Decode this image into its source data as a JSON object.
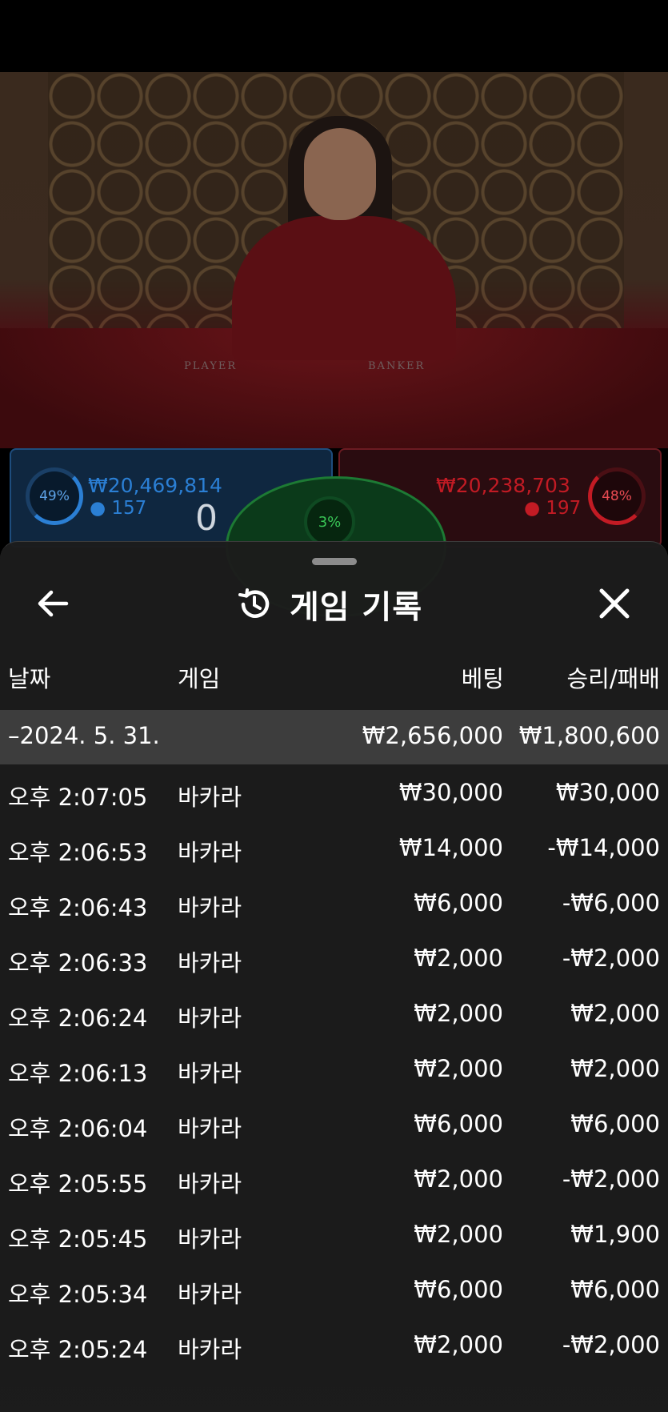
{
  "stream": {
    "player_label": "PLAYER",
    "banker_label": "BANKER"
  },
  "bets": {
    "player": {
      "percent": "49%",
      "amount": "₩20,469,814",
      "players": "157",
      "score": "0"
    },
    "tie": {
      "percent": "3%"
    },
    "banker": {
      "percent": "48%",
      "amount": "₩20,238,703",
      "players": "197"
    }
  },
  "sheet": {
    "title": "게임 기록",
    "columns": {
      "date": "날짜",
      "game": "게임",
      "bet": "베팅",
      "result": "승리/패배"
    },
    "summary": {
      "date": "–2024. 5. 31.",
      "bet": "₩2,656,000",
      "result": "₩1,800,600"
    },
    "rows": [
      {
        "time": "오후 2:07:05",
        "game": "바카라",
        "bet": "₩30,000",
        "result": "₩30,000"
      },
      {
        "time": "오후 2:06:53",
        "game": "바카라",
        "bet": "₩14,000",
        "result": "-₩14,000"
      },
      {
        "time": "오후 2:06:43",
        "game": "바카라",
        "bet": "₩6,000",
        "result": "-₩6,000"
      },
      {
        "time": "오후 2:06:33",
        "game": "바카라",
        "bet": "₩2,000",
        "result": "-₩2,000"
      },
      {
        "time": "오후 2:06:24",
        "game": "바카라",
        "bet": "₩2,000",
        "result": "₩2,000"
      },
      {
        "time": "오후 2:06:13",
        "game": "바카라",
        "bet": "₩2,000",
        "result": "₩2,000"
      },
      {
        "time": "오후 2:06:04",
        "game": "바카라",
        "bet": "₩6,000",
        "result": "₩6,000"
      },
      {
        "time": "오후 2:05:55",
        "game": "바카라",
        "bet": "₩2,000",
        "result": "-₩2,000"
      },
      {
        "time": "오후 2:05:45",
        "game": "바카라",
        "bet": "₩2,000",
        "result": "₩1,900"
      },
      {
        "time": "오후 2:05:34",
        "game": "바카라",
        "bet": "₩6,000",
        "result": "₩6,000"
      },
      {
        "time": "오후 2:05:24",
        "game": "바카라",
        "bet": "₩2,000",
        "result": "-₩2,000"
      }
    ]
  },
  "colors": {
    "player_blue": "#2b7fd4",
    "banker_red": "#c21b24",
    "tie_green": "#38c455",
    "sheet_bg": "#1c1c1c"
  },
  "icons": {
    "back": "arrow-left-icon",
    "history": "history-icon",
    "close": "close-icon",
    "person": "person-icon"
  }
}
